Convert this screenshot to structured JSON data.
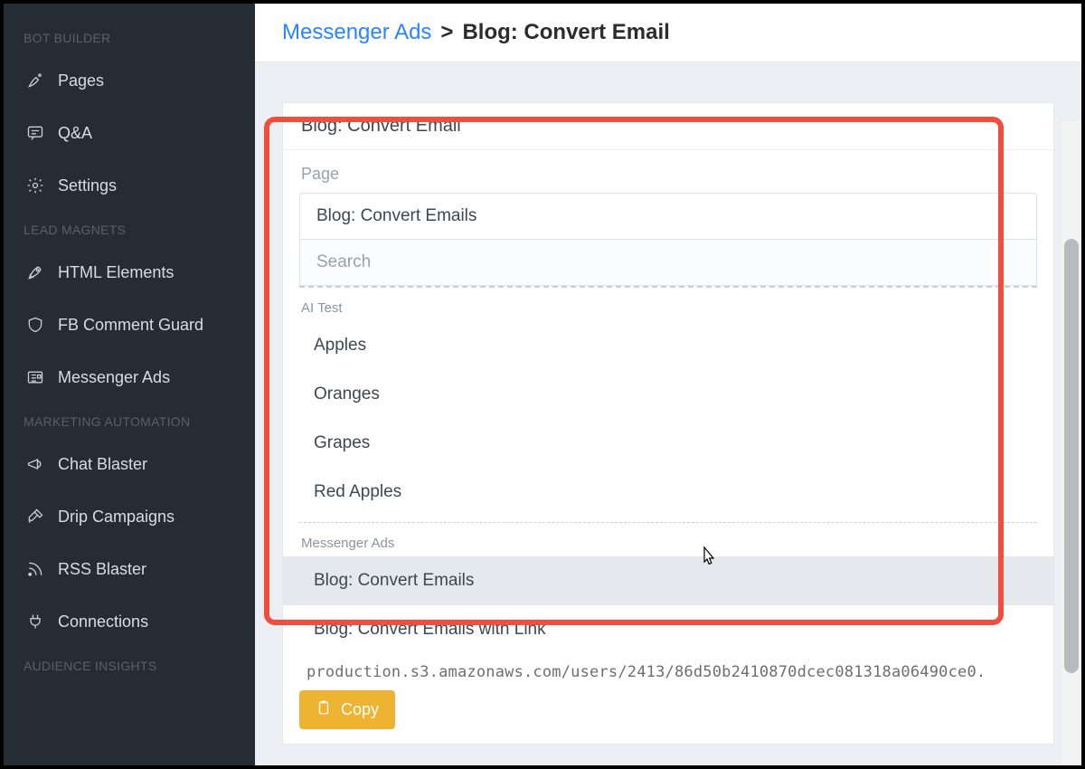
{
  "sidebar": {
    "sections": [
      {
        "title": "BOT BUILDER",
        "items": [
          {
            "icon": "pages",
            "label": "Pages"
          },
          {
            "icon": "qa",
            "label": "Q&A"
          },
          {
            "icon": "settings",
            "label": "Settings"
          }
        ]
      },
      {
        "title": "LEAD MAGNETS",
        "items": [
          {
            "icon": "rocket",
            "label": "HTML Elements"
          },
          {
            "icon": "shield",
            "label": "FB Comment Guard"
          },
          {
            "icon": "news",
            "label": "Messenger Ads"
          }
        ]
      },
      {
        "title": "MARKETING AUTOMATION",
        "items": [
          {
            "icon": "megaphone",
            "label": "Chat Blaster"
          },
          {
            "icon": "dropper",
            "label": "Drip Campaigns"
          },
          {
            "icon": "rss",
            "label": "RSS Blaster"
          },
          {
            "icon": "plug",
            "label": "Connections"
          }
        ]
      },
      {
        "title": "AUDIENCE INSIGHTS",
        "items": []
      }
    ]
  },
  "breadcrumb": {
    "section": "Messenger Ads",
    "separator": ">",
    "current": "Blog: Convert Email"
  },
  "panel": {
    "title": "Blog: Convert Email",
    "page_label": "Page",
    "selected_page": "Blog: Convert Emails",
    "search_placeholder": "Search",
    "groups": [
      {
        "name": "AI Test",
        "options": [
          "Apples",
          "Oranges",
          "Grapes",
          "Red Apples"
        ]
      },
      {
        "name": "Messenger Ads",
        "options": [
          "Blog: Convert Emails",
          "Blog: Convert Emails with Link"
        ]
      }
    ],
    "hovered_option": "Blog: Convert Emails",
    "url_fragment": "production.s3.amazonaws.com/users/2413/86d50b2410870dcec081318a06490ce0.",
    "copy_label": "Copy"
  }
}
